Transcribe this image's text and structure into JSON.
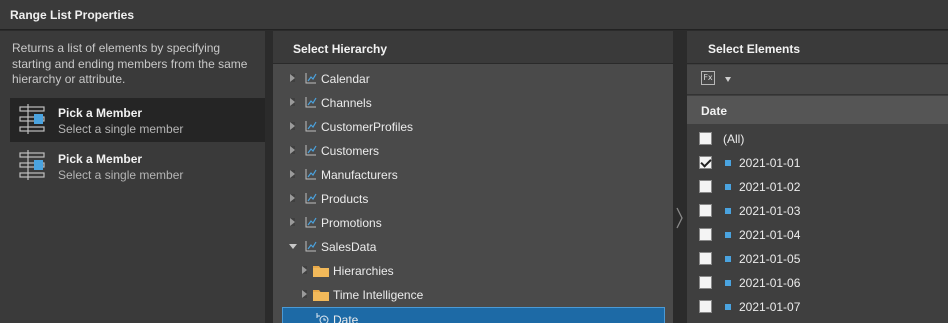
{
  "window": {
    "title": "Range List Properties"
  },
  "left_panel": {
    "description": "Returns a list of elements by specifying starting and ending members from the same hierarchy or attribute.",
    "options": [
      {
        "title": "Pick a Member",
        "subtitle": "Select a single member",
        "selected": true,
        "icon": "member-picker-icon"
      },
      {
        "title": "Pick a Member",
        "subtitle": "Select a single member",
        "selected": false,
        "icon": "member-picker-icon"
      }
    ]
  },
  "hierarchy_panel": {
    "header": "Select Hierarchy",
    "items": [
      {
        "label": "Calendar",
        "expanded": false,
        "icon": "hierarchy-icon"
      },
      {
        "label": "Channels",
        "expanded": false,
        "icon": "hierarchy-icon"
      },
      {
        "label": "CustomerProfiles",
        "expanded": false,
        "icon": "hierarchy-icon"
      },
      {
        "label": "Customers",
        "expanded": false,
        "icon": "hierarchy-icon"
      },
      {
        "label": "Manufacturers",
        "expanded": false,
        "icon": "hierarchy-icon"
      },
      {
        "label": "Products",
        "expanded": false,
        "icon": "hierarchy-icon"
      },
      {
        "label": "Promotions",
        "expanded": false,
        "icon": "hierarchy-icon"
      },
      {
        "label": "SalesData",
        "expanded": true,
        "icon": "hierarchy-icon"
      },
      {
        "label": "Hierarchies",
        "expanded": false,
        "icon": "folder-icon"
      },
      {
        "label": "Time Intelligence",
        "expanded": false,
        "icon": "folder-icon"
      },
      {
        "label": "Date",
        "selected": true,
        "icon": "date-hierarchy-icon"
      }
    ]
  },
  "elements_panel": {
    "header": "Select Elements",
    "toolbar": {
      "formula_icon": "formula-icon",
      "dropdown_icon": "caret-down-icon"
    },
    "column_header": "Date",
    "items": [
      {
        "label": "(All)",
        "checked": false
      },
      {
        "label": "2021-01-01",
        "checked": true
      },
      {
        "label": "2021-01-02",
        "checked": false
      },
      {
        "label": "2021-01-03",
        "checked": false
      },
      {
        "label": "2021-01-04",
        "checked": false
      },
      {
        "label": "2021-01-05",
        "checked": false
      },
      {
        "label": "2021-01-06",
        "checked": false
      },
      {
        "label": "2021-01-07",
        "checked": false
      }
    ]
  },
  "colors": {
    "accent": "#1d6aa6",
    "member_square": "#4aa3df",
    "folder": "#e8a848",
    "panel_dark": "#2b2b2b",
    "panel_mid": "#4a4a4a"
  }
}
